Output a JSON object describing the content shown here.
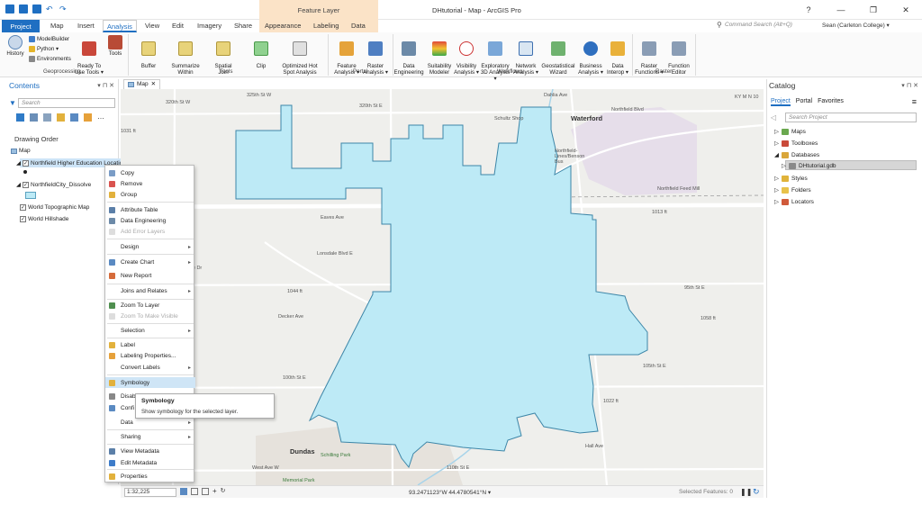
{
  "window": {
    "title": "DHtutorial - Map - ArcGIS Pro",
    "context_tab_group": "Feature Layer",
    "controls": [
      "?",
      "—",
      "❐",
      "✕"
    ]
  },
  "tabs": [
    "Project",
    "Map",
    "Insert",
    "Analysis",
    "View",
    "Edit",
    "Imagery",
    "Share",
    "Appearance",
    "Labeling",
    "Data"
  ],
  "active_tab": "Analysis",
  "command_search": {
    "placeholder": "Command Search (Alt+Q)"
  },
  "user": "Sean (Carleton College) ▾",
  "ribbon": {
    "geoprocessing": {
      "label": "Geoprocessing",
      "history": "History",
      "modelbuilder": "ModelBuilder",
      "python": "Python ▾",
      "environments": "Environments",
      "ready_to_use": "Ready To\nUse Tools ▾",
      "tools": "Tools"
    },
    "tools_group": {
      "label": "Tools",
      "items": [
        "Buffer",
        "Summarize\nWithin",
        "Spatial\nJoin",
        "Clip",
        "Optimized Hot\nSpot Analysis"
      ]
    },
    "portal": {
      "label": "Portal",
      "items": [
        "Feature\nAnalysis ▾",
        "Raster\nAnalysis ▾"
      ]
    },
    "workflows": {
      "label": "Workflows",
      "items": [
        "Data\nEngineering",
        "Suitability\nModeler",
        "Visibility\nAnalysis ▾",
        "Exploratory\n3D Analysis ▾",
        "Network\nAnalysis ▾",
        "Geostatistical\nWizard",
        "Business\nAnalysis ▾",
        "Data\nInterop ▾"
      ]
    },
    "raster": {
      "label": "Raster",
      "items": [
        "Raster\nFunctions ▾",
        "Function\nEditor"
      ]
    }
  },
  "contents": {
    "title": "Contents",
    "search_placeholder": "Search",
    "drawing_order": "Drawing Order",
    "layers": {
      "map": "Map",
      "northfield_higher": "Northfield Higher Education Locations",
      "northfield_city": "NorthfieldCity_Dissolve",
      "topo": "World Topographic Map",
      "hillshade": "World Hillshade"
    }
  },
  "map_tab": "Map",
  "context_menu": [
    {
      "label": "Copy",
      "icon": "copy-icon"
    },
    {
      "label": "Remove",
      "icon": "remove-icon"
    },
    {
      "label": "Group",
      "icon": "group-icon"
    },
    {
      "label": "Attribute Table",
      "icon": "table-icon"
    },
    {
      "label": "Data Engineering",
      "icon": "data-engineering-icon"
    },
    {
      "label": "Add Error Layers",
      "icon": "error-layers-icon",
      "disabled": true
    },
    {
      "label": "Design",
      "submenu": true
    },
    {
      "label": "Create Chart",
      "submenu": true
    },
    {
      "label": "New Report",
      "icon": "report-icon"
    },
    {
      "label": "Joins and Relates",
      "submenu": true
    },
    {
      "label": "Zoom To Layer",
      "icon": "zoom-layer-icon"
    },
    {
      "label": "Zoom To Make Visible",
      "disabled": true
    },
    {
      "label": "Selection",
      "submenu": true
    },
    {
      "label": "Label",
      "icon": "label-icon"
    },
    {
      "label": "Labeling Properties...",
      "icon": "labeling-icon"
    },
    {
      "label": "Convert Labels",
      "submenu": true
    },
    {
      "label": "Symbology",
      "icon": "symbology-icon",
      "highlighted": true
    },
    {
      "label": "Disab",
      "icon": "disable-icon"
    },
    {
      "label": "Confi",
      "icon": "configure-icon"
    },
    {
      "label": "Data",
      "submenu": true
    },
    {
      "label": "Sharing",
      "submenu": true
    },
    {
      "label": "View Metadata",
      "icon": "metadata-icon"
    },
    {
      "label": "Edit Metadata",
      "icon": "edit-metadata-icon"
    },
    {
      "label": "Properties",
      "icon": "properties-icon"
    }
  ],
  "tooltip": {
    "title": "Symbology",
    "text": "Show symbology for the selected layer."
  },
  "map_labels": {
    "waterford": "Waterford",
    "dundas": "Dundas",
    "schultz": "Schultz Shop",
    "northfield_lines": "Northfield-\nLines/Benson\nBus",
    "roads": [
      "320th St W",
      "320th St E",
      "325th St W",
      "Northfield Blvd",
      "Northfield Feed Mill",
      "Eaves Ave",
      "Lonsdale Blvd E",
      "Decker Ave",
      "95th St E",
      "100th St E",
      "105th St E",
      "110th St E",
      "West Ave W",
      "Hall Ave",
      "Dahlia Ave",
      "Riverside Dr"
    ],
    "parks": [
      "Schilling Park",
      "Memorial Park"
    ],
    "elevations": [
      "1044 ft",
      "1013 ft",
      "1058 ft",
      "1022 ft",
      "1031 ft"
    ],
    "attribution": "KY M N 10"
  },
  "status": {
    "scale": "1:32,225",
    "coords": "93.2471123°W 44.4780541°N ▾",
    "selected": "Selected Features: 0"
  },
  "catalog": {
    "title": "Catalog",
    "tabs": [
      "Project",
      "Portal",
      "Favorites"
    ],
    "search_placeholder": "Search Project",
    "items": [
      "Maps",
      "Toolboxes",
      "Databases",
      "DHtutorial.gdb",
      "Styles",
      "Folders",
      "Locators"
    ]
  },
  "colors": {
    "accent": "#1f6fc2",
    "city_fill": "#bdeaf6",
    "city_stroke": "#3d86a8",
    "menu_highlight": "#cfe5f6"
  }
}
